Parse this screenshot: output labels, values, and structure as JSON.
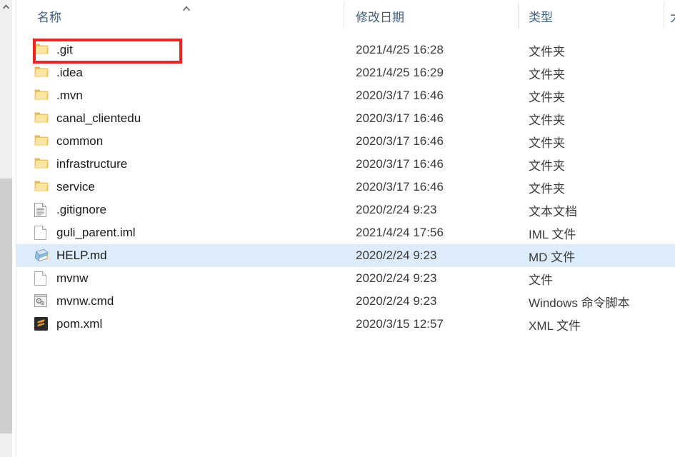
{
  "window": {
    "title": "File Explorer file list"
  },
  "scrollbar": {
    "up_arrow_icon": "chevron-up-icon",
    "orientation": "vertical",
    "position": "left"
  },
  "columns": {
    "name": "名称",
    "date_modified": "修改日期",
    "type": "类型",
    "size": "大",
    "sort_column": "名称",
    "sort_direction": "ascending",
    "sort_icon": "chevron-up-icon"
  },
  "colors": {
    "header_text": "#3f5f80",
    "row_text": "#1b1b1b",
    "meta_text": "#3a3a3a",
    "selection": "#dcecfa",
    "annotation": "#f52020",
    "folder": "#f4cf68",
    "scrollbar_thumb": "#cdcdcd",
    "scrollbar_track": "#f0f0f0"
  },
  "annotation": {
    "target": ".git",
    "shape": "rectangle",
    "color": "#f52020"
  },
  "rows": [
    {
      "name": ".git",
      "date_modified": "2021/4/25 16:28",
      "type": "文件夹",
      "icon": "folder-icon",
      "selected": false,
      "annotated": true
    },
    {
      "name": ".idea",
      "date_modified": "2021/4/25 16:29",
      "type": "文件夹",
      "icon": "folder-icon",
      "selected": false,
      "annotated": false
    },
    {
      "name": ".mvn",
      "date_modified": "2020/3/17 16:46",
      "type": "文件夹",
      "icon": "folder-icon",
      "selected": false,
      "annotated": false
    },
    {
      "name": "canal_clientedu",
      "date_modified": "2020/3/17 16:46",
      "type": "文件夹",
      "icon": "folder-icon",
      "selected": false,
      "annotated": false
    },
    {
      "name": "common",
      "date_modified": "2020/3/17 16:46",
      "type": "文件夹",
      "icon": "folder-icon",
      "selected": false,
      "annotated": false
    },
    {
      "name": "infrastructure",
      "date_modified": "2020/3/17 16:46",
      "type": "文件夹",
      "icon": "folder-icon",
      "selected": false,
      "annotated": false
    },
    {
      "name": "service",
      "date_modified": "2020/3/17 16:46",
      "type": "文件夹",
      "icon": "folder-icon",
      "selected": false,
      "annotated": false
    },
    {
      "name": ".gitignore",
      "date_modified": "2020/2/24 9:23",
      "type": "文本文档",
      "icon": "text-document-icon",
      "selected": false,
      "annotated": false
    },
    {
      "name": "guli_parent.iml",
      "date_modified": "2021/4/24 17:56",
      "type": "IML 文件",
      "icon": "blank-document-icon",
      "selected": false,
      "annotated": false
    },
    {
      "name": "HELP.md",
      "date_modified": "2020/2/24 9:23",
      "type": "MD 文件",
      "icon": "markdown-notepad-icon",
      "selected": true,
      "annotated": false
    },
    {
      "name": "mvnw",
      "date_modified": "2020/2/24 9:23",
      "type": "文件",
      "icon": "blank-document-icon",
      "selected": false,
      "annotated": false
    },
    {
      "name": "mvnw.cmd",
      "date_modified": "2020/2/24 9:23",
      "type": "Windows 命令脚本",
      "icon": "cmd-script-icon",
      "selected": false,
      "annotated": false
    },
    {
      "name": "pom.xml",
      "date_modified": "2020/3/15 12:57",
      "type": "XML 文件",
      "icon": "sublime-text-icon",
      "selected": false,
      "annotated": false
    }
  ]
}
